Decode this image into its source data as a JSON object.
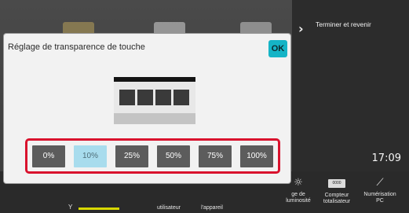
{
  "dialog": {
    "title": "Réglage de transparence de touche",
    "ok_label": "OK",
    "options": [
      "0%",
      "10%",
      "25%",
      "50%",
      "75%",
      "100%"
    ],
    "selected_option": "10%"
  },
  "side_panel": {
    "link_label": "Terminer et revenir"
  },
  "status": {
    "time": "17:09"
  },
  "bottom_bar": {
    "shortcut_user": "utilisateur",
    "shortcut_device": "l'appareil",
    "shortcut_brightness": "ge de\nluminosité",
    "shortcut_counter": "Compteur\ntotalisateur",
    "shortcut_scan": "Numérisation\nPC",
    "y_label": "Y"
  },
  "colors": {
    "accent": "#15b4c6",
    "selected_option_bg": "#a8dced",
    "highlight_frame": "#d9122d",
    "option_bg": "#5c5c5c"
  },
  "icons": {
    "side_chevron": "chevron-right-icon",
    "brightness": "sun-icon",
    "counter": "counter-icon",
    "scan": "scan-icon"
  }
}
